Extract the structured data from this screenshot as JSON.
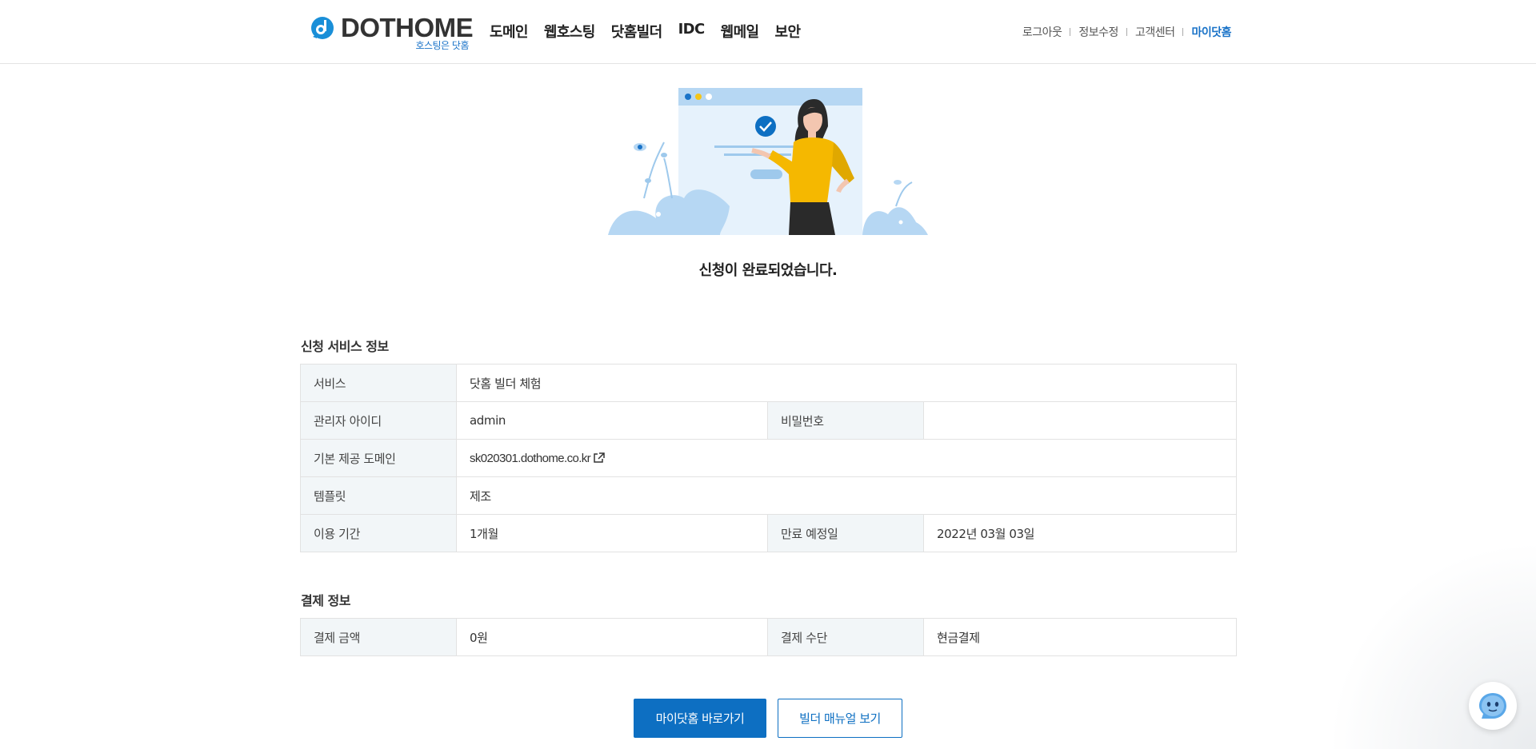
{
  "header": {
    "logo_text": "DOTHOME",
    "logo_sub": "호스팅은 닷홈",
    "nav": [
      "도메인",
      "웹호스팅",
      "닷홈빌더",
      "IDC",
      "웹메일",
      "보안"
    ],
    "util": {
      "logout": "로그아웃",
      "edit_info": "정보수정",
      "support": "고객센터",
      "my_dothome": "마이닷홈"
    }
  },
  "main": {
    "done_message": "신청이 완료되었습니다.",
    "service_section": {
      "title": "신청 서비스 정보",
      "service_label": "서비스",
      "service_value": "닷홈 빌더 체험",
      "admin_id_label": "관리자 아이디",
      "admin_id_value": "admin",
      "password_label": "비밀번호",
      "password_value": "",
      "domain_label": "기본 제공 도메인",
      "domain_value": "sk020301.dothome.co.kr",
      "template_label": "템플릿",
      "template_value": "제조",
      "period_label": "이용 기간",
      "period_value": "1개월",
      "expire_label": "만료 예정일",
      "expire_value": "2022년 03월 03일"
    },
    "payment_section": {
      "title": "결제 정보",
      "amount_label": "결제 금액",
      "amount_value": "0원",
      "method_label": "결제 수단",
      "method_value": "현금결제"
    },
    "buttons": {
      "go_my_dothome": "마이닷홈 바로가기",
      "builder_manual": "빌더 매뉴얼 보기"
    }
  },
  "colors": {
    "brand": "#0d6fc2",
    "header_link_active": "#1a73c8",
    "table_header_bg": "#f2f6f8"
  },
  "icons": [
    "logo-d-icon",
    "external-link-icon",
    "check-icon",
    "chat-bot-icon"
  ]
}
